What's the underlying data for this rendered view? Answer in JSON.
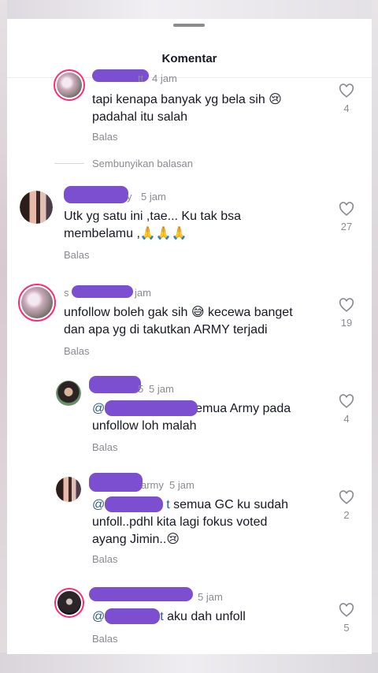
{
  "header": {
    "title": "Komentar"
  },
  "labels": {
    "reply": "Balas",
    "hide_replies": "Sembunyikan balasan"
  },
  "comments": [
    {
      "username_suffix": "tt",
      "time": "4 jam",
      "text_lines": [
        "tapi kenapa banyak yg bela sih 😢",
        "padahal itu salah"
      ],
      "likes": "4"
    },
    {
      "username_suffix": "y",
      "time": "5 jam",
      "text_lines": [
        "Utk yg satu ini ,tae... Ku tak bsa",
        "membelamu ,🙏🙏🙏"
      ],
      "likes": "27"
    },
    {
      "username_prefix": "s",
      "time": "jam",
      "text_lines": [
        "unfollow boleh gak sih 😅 kecewa banget",
        "dan apa yg di takutkan ARMY terjadi"
      ],
      "likes": "19"
    },
    {
      "username_suffix": "5",
      "time": "5 jam",
      "mention_prefix": "@s",
      "mention_suffix": "t",
      "text_lines": [
        "semua Army pada",
        "unfollow loh malah"
      ],
      "likes": "4"
    },
    {
      "username_suffix": "army",
      "time": "5 jam",
      "mention_prefix": "@s",
      "mention_suffix": "t",
      "text_lines": [
        "semua GC ku sudah",
        "unfoll..pdhl kita lagi fokus voted",
        "ayang Jimin..😢"
      ],
      "likes": "2"
    },
    {
      "time": "5 jam",
      "mention_prefix": "@s",
      "mention_suffix": "t",
      "text_lines": [
        "aku dah unfoll"
      ],
      "likes": "5"
    }
  ],
  "colors": {
    "redaction": "#7c4fd0",
    "mention": "#2b5d8c",
    "secondary_text": "#8a8b91",
    "avatar_ring": "#ff2b79"
  }
}
